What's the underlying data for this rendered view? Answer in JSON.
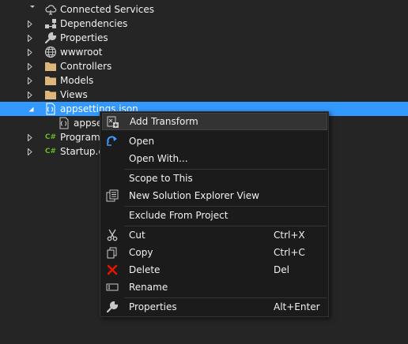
{
  "tree": {
    "items": [
      {
        "label": "Connected Services",
        "icon": "connected-services-icon"
      },
      {
        "label": "Dependencies",
        "icon": "dependencies-icon"
      },
      {
        "label": "Properties",
        "icon": "wrench-icon"
      },
      {
        "label": "wwwroot",
        "icon": "globe-icon"
      },
      {
        "label": "Controllers",
        "icon": "folder-icon"
      },
      {
        "label": "Models",
        "icon": "folder-icon"
      },
      {
        "label": "Views",
        "icon": "folder-icon"
      },
      {
        "label": "appsettings.json",
        "icon": "json-file-icon"
      },
      {
        "label": "appse",
        "icon": "json-file-icon"
      },
      {
        "label": "Program.",
        "icon": "csharp-file-icon"
      },
      {
        "label": "Startup.cs",
        "icon": "csharp-file-icon"
      }
    ]
  },
  "menu": {
    "items": [
      {
        "label": "Add Transform",
        "shortcut": "",
        "icon": "add-transform-icon"
      },
      {
        "label": "Open",
        "shortcut": "",
        "icon": "open-icon"
      },
      {
        "label": "Open With...",
        "shortcut": ""
      },
      {
        "label": "Scope to This",
        "shortcut": ""
      },
      {
        "label": "New Solution Explorer View",
        "shortcut": "",
        "icon": "new-view-icon"
      },
      {
        "label": "Exclude From Project",
        "shortcut": ""
      },
      {
        "label": "Cut",
        "shortcut": "Ctrl+X",
        "icon": "cut-icon"
      },
      {
        "label": "Copy",
        "shortcut": "Ctrl+C",
        "icon": "copy-icon"
      },
      {
        "label": "Delete",
        "shortcut": "Del",
        "icon": "delete-icon"
      },
      {
        "label": "Rename",
        "shortcut": "",
        "icon": "rename-icon"
      },
      {
        "label": "Properties",
        "shortcut": "Alt+Enter",
        "icon": "wrench-icon"
      }
    ]
  },
  "colors": {
    "background": "#252526",
    "selection": "#3399ff",
    "menu_background": "#1b1b1c",
    "folder": "#dcb67a",
    "csharp": "#68b723",
    "delete": "#e51400"
  }
}
